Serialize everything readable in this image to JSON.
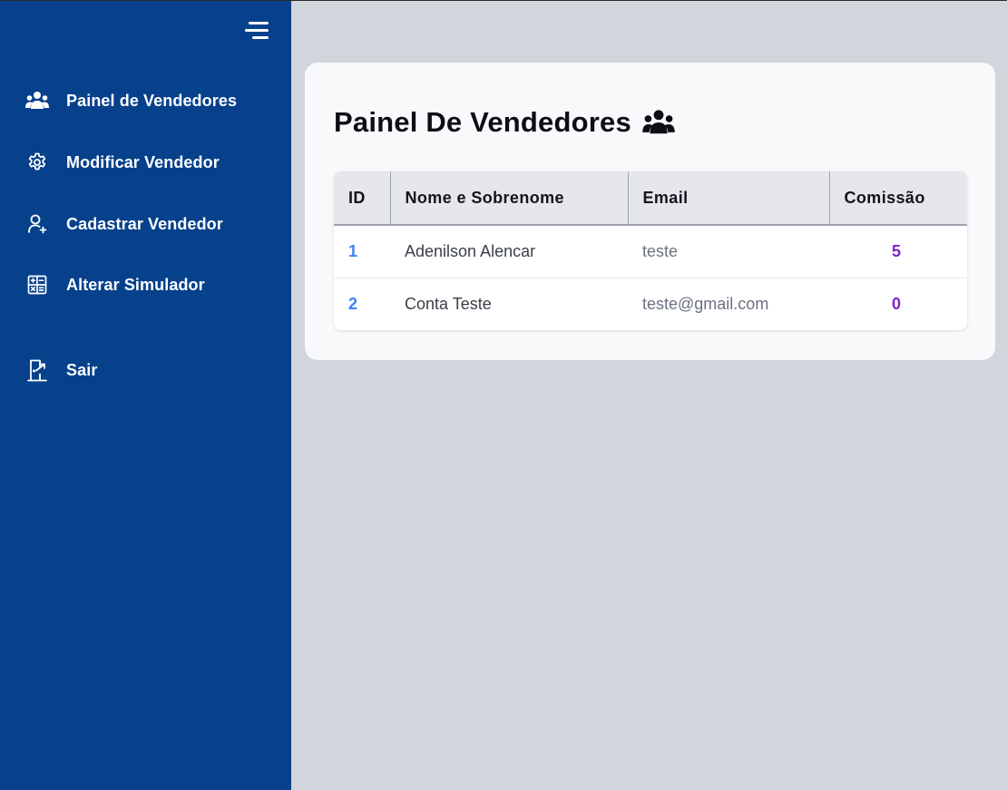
{
  "sidebar": {
    "menu_icon": "hamburger-menu-icon",
    "items": [
      {
        "label": "Painel de Vendedores",
        "icon": "users-icon"
      },
      {
        "label": "Modificar Vendedor",
        "icon": "gear-icon"
      },
      {
        "label": "Cadastrar Vendedor",
        "icon": "user-plus-icon"
      },
      {
        "label": "Alterar Simulador",
        "icon": "calculator-icon"
      }
    ],
    "logout": {
      "label": "Sair",
      "icon": "logout-door-icon"
    }
  },
  "main": {
    "title": "Painel De Vendedores",
    "title_icon": "users-icon",
    "table": {
      "columns": [
        "ID",
        "Nome e Sobrenome",
        "Email",
        "Comissão"
      ],
      "rows": [
        {
          "id": "1",
          "name": "Adenilson Alencar",
          "email": "teste",
          "commission": "5"
        },
        {
          "id": "2",
          "name": "Conta Teste",
          "email": "teste@gmail.com",
          "commission": "0"
        }
      ]
    }
  },
  "colors": {
    "sidebar_bg": "#07418c",
    "page_bg": "#d1d5dc",
    "id_color": "#3b82f6",
    "commission_color": "#7e22ce"
  }
}
